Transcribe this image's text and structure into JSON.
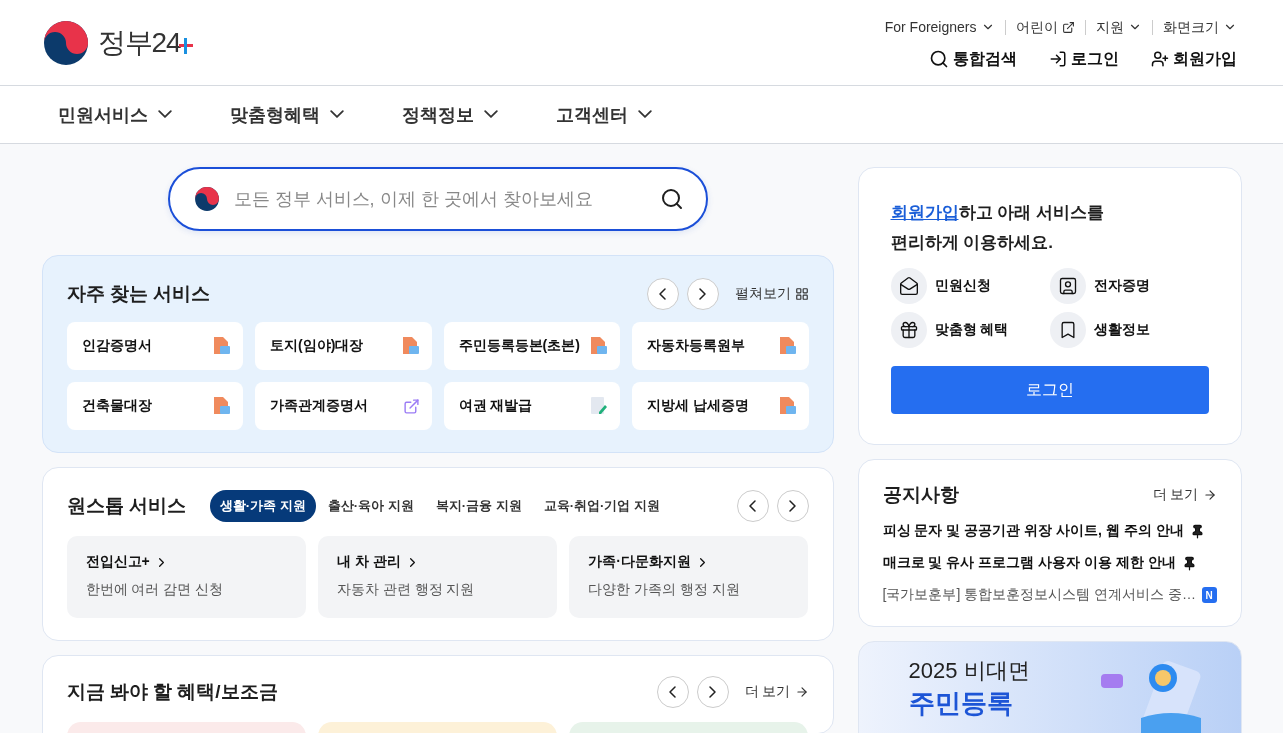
{
  "logo": {
    "text": "정부24"
  },
  "utility_links": [
    {
      "label": "For Foreigners",
      "kind": "dropdown"
    },
    {
      "label": "어린이",
      "kind": "external"
    },
    {
      "label": "지원",
      "kind": "dropdown"
    },
    {
      "label": "화면크기",
      "kind": "dropdown"
    }
  ],
  "header_actions": [
    {
      "label": "통합검색",
      "kind": "search"
    },
    {
      "label": "로그인",
      "kind": "login"
    },
    {
      "label": "회원가입",
      "kind": "signup"
    }
  ],
  "nav": [
    "민원서비스",
    "맞춤형혜택",
    "정책정보",
    "고객센터"
  ],
  "search": {
    "placeholder": "모든 정부 서비스, 이제 한 곳에서 찾아보세요"
  },
  "frequent_services": {
    "title": "자주 찾는 서비스",
    "expand": "펼쳐보기",
    "items": [
      {
        "label": "인감증명서",
        "kind": "pdf"
      },
      {
        "label": "토지(임야)대장",
        "kind": "pdf"
      },
      {
        "label": "주민등록등본(초본)",
        "kind": "pdf"
      },
      {
        "label": "자동차등록원부",
        "kind": "pdf"
      },
      {
        "label": "건축물대장",
        "kind": "pdf"
      },
      {
        "label": "가족관계증명서",
        "kind": "link"
      },
      {
        "label": "여권 재발급",
        "kind": "edit"
      },
      {
        "label": "지방세 납세증명",
        "kind": "pdf"
      }
    ]
  },
  "onestop": {
    "title": "원스톱 서비스",
    "tabs": [
      {
        "label": "생활·가족 지원",
        "selected": true
      },
      {
        "label": "출산·육아 지원",
        "selected": false
      },
      {
        "label": "복지·금융 지원",
        "selected": false
      },
      {
        "label": "교육·취업·기업 지원",
        "selected": false
      }
    ],
    "cards": [
      {
        "title": "전입신고+",
        "desc": "한번에 여러 감면 신청"
      },
      {
        "title": "내 차 관리",
        "desc": "자동차 관련 행정 지원"
      },
      {
        "title": "가족·다문화지원",
        "desc": "다양한 가족의 행정 지원"
      }
    ]
  },
  "benefits": {
    "title": "지금 봐야 할 혜택/보조금",
    "more": "더 보기",
    "cards": [
      {
        "color": "#fbeaea"
      },
      {
        "color": "#fdf1d8"
      },
      {
        "color": "#e7f3ea"
      }
    ]
  },
  "login_card": {
    "link": "회원가입",
    "line1": "하고 아래 서비스를",
    "line2": "편리하게 이용하세요.",
    "services": [
      {
        "label": "민원신청",
        "kind": "mail"
      },
      {
        "label": "전자증명",
        "kind": "badge"
      },
      {
        "label": "맞춤형 혜택",
        "kind": "gift"
      },
      {
        "label": "생활정보",
        "kind": "book"
      }
    ],
    "button": "로그인"
  },
  "notices": {
    "title": "공지사항",
    "more": "더 보기",
    "items": [
      {
        "text": "피싱 문자 및 공공기관 위장 사이트, 웹 주의 안내",
        "pinned": true
      },
      {
        "text": "매크로 및 유사 프로그램 사용자 이용 제한 안내",
        "pinned": true
      },
      {
        "text": "[국가보훈부] 통합보훈정보시스템 연계서비스 중…",
        "pinned": false,
        "badge": "N"
      }
    ]
  },
  "banner": {
    "line1": "2025 비대면",
    "line2": "주민등록"
  }
}
